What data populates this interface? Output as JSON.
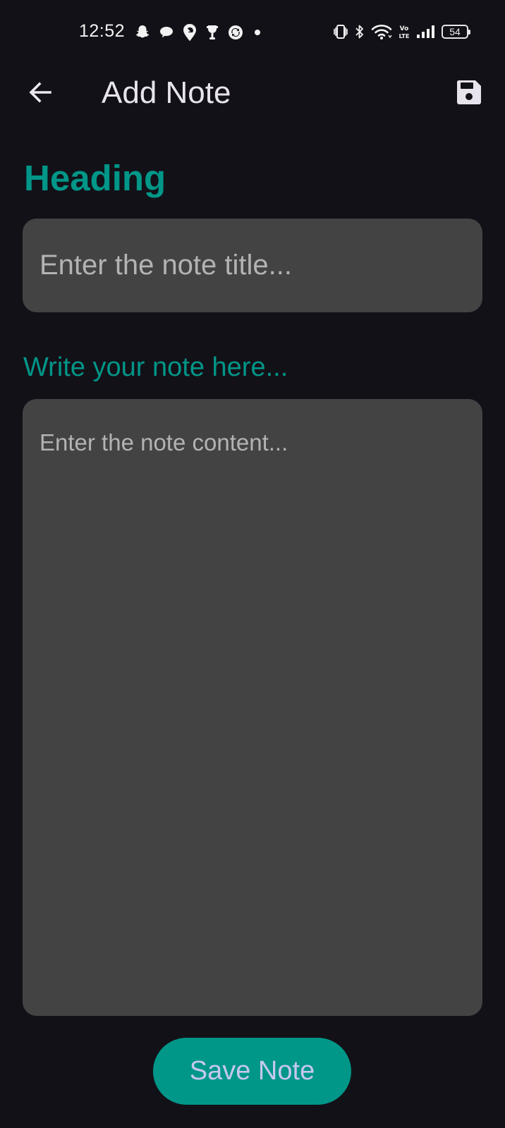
{
  "status_bar": {
    "time": "12:52",
    "battery_level": "54",
    "notification_icons": [
      "snapchat-icon",
      "chat-bubble-icon",
      "swiggy-icon",
      "trophy-icon",
      "sync-app-icon",
      "more-dot-icon"
    ],
    "system_icons": [
      "vibrate-icon",
      "bluetooth-icon",
      "wifi-icon",
      "volte-icon",
      "signal-icon",
      "battery-icon"
    ]
  },
  "app_bar": {
    "title": "Add Note",
    "back_icon": "arrow-left-icon",
    "save_icon": "floppy-disk-icon"
  },
  "form": {
    "heading_label": "Heading",
    "title_placeholder": "Enter the note title...",
    "title_value": "",
    "content_label": "Write your note here...",
    "content_placeholder": "Enter the note content...",
    "content_value": ""
  },
  "actions": {
    "save_note_label": "Save Note"
  },
  "colors": {
    "background": "#131118",
    "accent": "#009688",
    "field_background": "#434343",
    "button_text": "#c5c8ef"
  }
}
